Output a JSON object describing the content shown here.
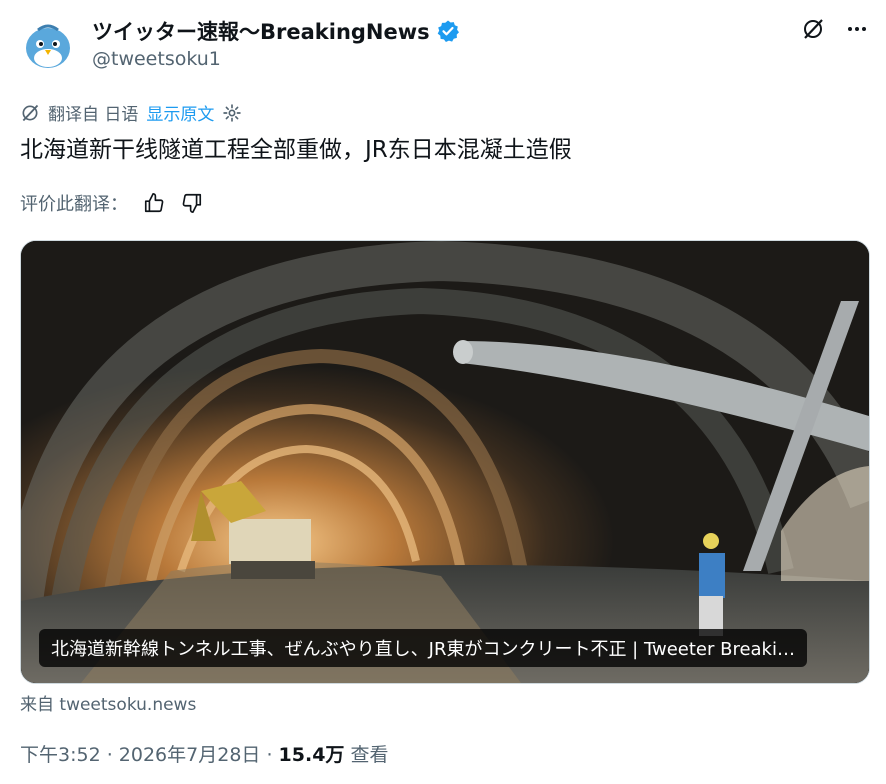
{
  "author": {
    "name": "ツイッター速報〜BreakingNews",
    "handle": "@tweetsoku1",
    "verified": true
  },
  "translation": {
    "label": "翻译自 日语",
    "show_original": "显示原文"
  },
  "tweet_text": "北海道新干线隧道工程全部重做，JR东日本混凝土造假",
  "rate": {
    "label": "评价此翻译："
  },
  "card": {
    "caption": "北海道新幹線トンネル工事、ぜんぶやり直し、JR東がコンクリート不正 | Tweeter Breaki…",
    "source": "来自 tweetsoku.news"
  },
  "meta": {
    "time": "下午3:52",
    "sep1": " · ",
    "date": "2026年7月28日",
    "sep2": " · ",
    "views_count": "15.4万",
    "views_label": " 查看"
  },
  "colors": {
    "accent": "#1d9bf0",
    "secondary_text": "#536471",
    "primary_text": "#0f1419"
  }
}
